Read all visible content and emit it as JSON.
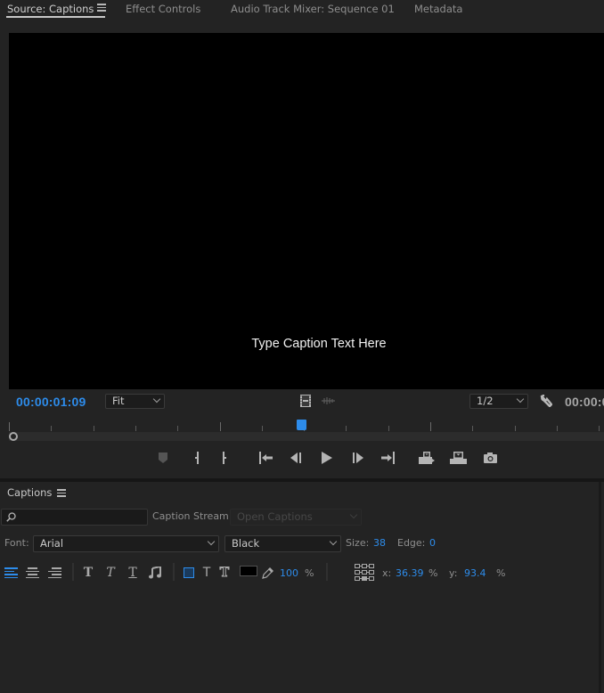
{
  "tabs": [
    {
      "label": "Source: Captions",
      "active": true
    },
    {
      "label": "Effect Controls",
      "active": false
    },
    {
      "label": "Audio Track Mixer: Sequence 01",
      "active": false
    },
    {
      "label": "Metadata",
      "active": false
    }
  ],
  "viewer": {
    "caption_text": "Type Caption Text Here",
    "current_timecode": "00:00:01:09",
    "duration_timecode": "00:00:0",
    "zoom_level": "Fit",
    "resolution": "1/2"
  },
  "icons": {
    "panel_menu": "hamburger-menu-icon",
    "drag_video": "film-strip-icon",
    "drag_audio": "audio-waveform-icon",
    "settings": "wrench-icon"
  },
  "transport": [
    {
      "name": "add-marker",
      "icon": "marker-icon"
    },
    {
      "name": "mark-in",
      "icon": "mark-in-icon"
    },
    {
      "name": "mark-out",
      "icon": "mark-out-icon"
    },
    {
      "name": "go-to-in",
      "icon": "go-to-in-icon"
    },
    {
      "name": "step-back",
      "icon": "step-back-icon"
    },
    {
      "name": "play",
      "icon": "play-icon"
    },
    {
      "name": "step-forward",
      "icon": "step-forward-icon"
    },
    {
      "name": "go-to-out",
      "icon": "go-to-out-icon"
    },
    {
      "name": "insert",
      "icon": "insert-icon"
    },
    {
      "name": "overwrite",
      "icon": "overwrite-icon"
    },
    {
      "name": "export-frame",
      "icon": "camera-icon"
    }
  ],
  "captions_panel": {
    "title": "Captions",
    "search_value": "",
    "caption_stream_label": "Caption Stream:",
    "caption_stream_value": "Open Captions",
    "font_label": "Font:",
    "font_value": "Arial",
    "font_style_value": "Black",
    "size_label": "Size:",
    "size_value": "38",
    "edge_label": "Edge:",
    "edge_value": "0",
    "opacity_value": "100",
    "opacity_unit": "%",
    "x_label": "x:",
    "x_value": "36.39",
    "x_unit": "%",
    "y_label": "y:",
    "y_value": "93.4",
    "y_unit": "%",
    "text_color": "#000000",
    "accent_color": "#2d8ceb"
  }
}
